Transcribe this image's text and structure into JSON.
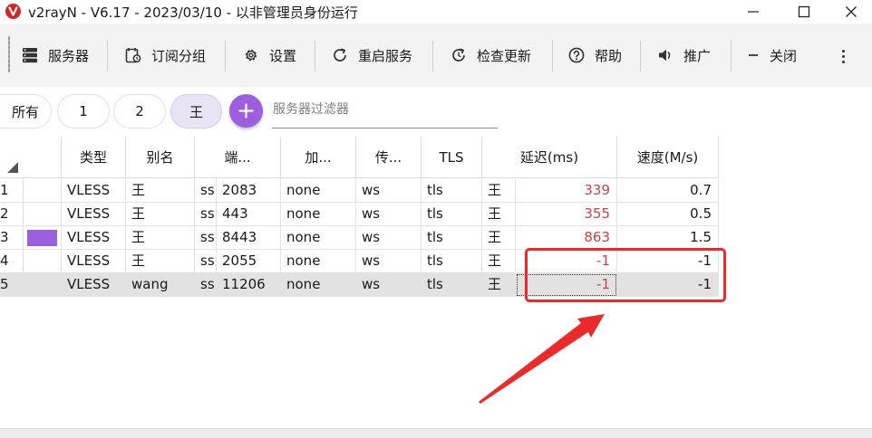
{
  "window": {
    "title": "v2rayN - V6.17 - 2023/03/10 - 以非管理员身份运行"
  },
  "toolbar": {
    "servers": "服务器",
    "subscriptions": "订阅分组",
    "settings": "设置",
    "restart": "重启服务",
    "check_update": "检查更新",
    "help": "帮助",
    "promote": "推广",
    "close": "关闭"
  },
  "groups": {
    "chips": [
      "所有",
      "1",
      "2",
      "王"
    ],
    "active": "王",
    "filter_placeholder": "服务器过滤器"
  },
  "table": {
    "headers": {
      "type": "类型",
      "alias": "别名",
      "port": "端...",
      "encryption": "加...",
      "transport": "传...",
      "tls": "TLS",
      "latency": "延迟(ms)",
      "speed": "速度(M/s)"
    },
    "rows": [
      {
        "no": "1",
        "type": "VLESS",
        "alias": "王",
        "ss": "ss",
        "port": "2083",
        "encryption": "none",
        "transport": "ws",
        "tls": "tls",
        "sub": "王",
        "latency": "339",
        "speed": "0.7",
        "has_color": false
      },
      {
        "no": "2",
        "type": "VLESS",
        "alias": "王",
        "ss": "ss",
        "port": "443",
        "encryption": "none",
        "transport": "ws",
        "tls": "tls",
        "sub": "王",
        "latency": "355",
        "speed": "0.5",
        "has_color": false
      },
      {
        "no": "3",
        "type": "VLESS",
        "alias": "王",
        "ss": "ss",
        "port": "8443",
        "encryption": "none",
        "transport": "ws",
        "tls": "tls",
        "sub": "王",
        "latency": "863",
        "speed": "1.5",
        "has_color": true
      },
      {
        "no": "4",
        "type": "VLESS",
        "alias": "王",
        "ss": "ss",
        "port": "2055",
        "encryption": "none",
        "transport": "ws",
        "tls": "tls",
        "sub": "王",
        "latency": "-1",
        "speed": "-1",
        "has_color": false
      },
      {
        "no": "5",
        "type": "VLESS",
        "alias": "wang",
        "ss": "ss",
        "port": "11206",
        "encryption": "none",
        "transport": "ws",
        "tls": "tls",
        "sub": "王",
        "latency": "-1",
        "speed": "-1",
        "has_color": false
      }
    ],
    "selected_row": 4
  },
  "colors": {
    "accent": "#9c5fe0",
    "latency_text": "#d0404a",
    "annotation": "#ec2a2a",
    "logo": "#d42525"
  }
}
